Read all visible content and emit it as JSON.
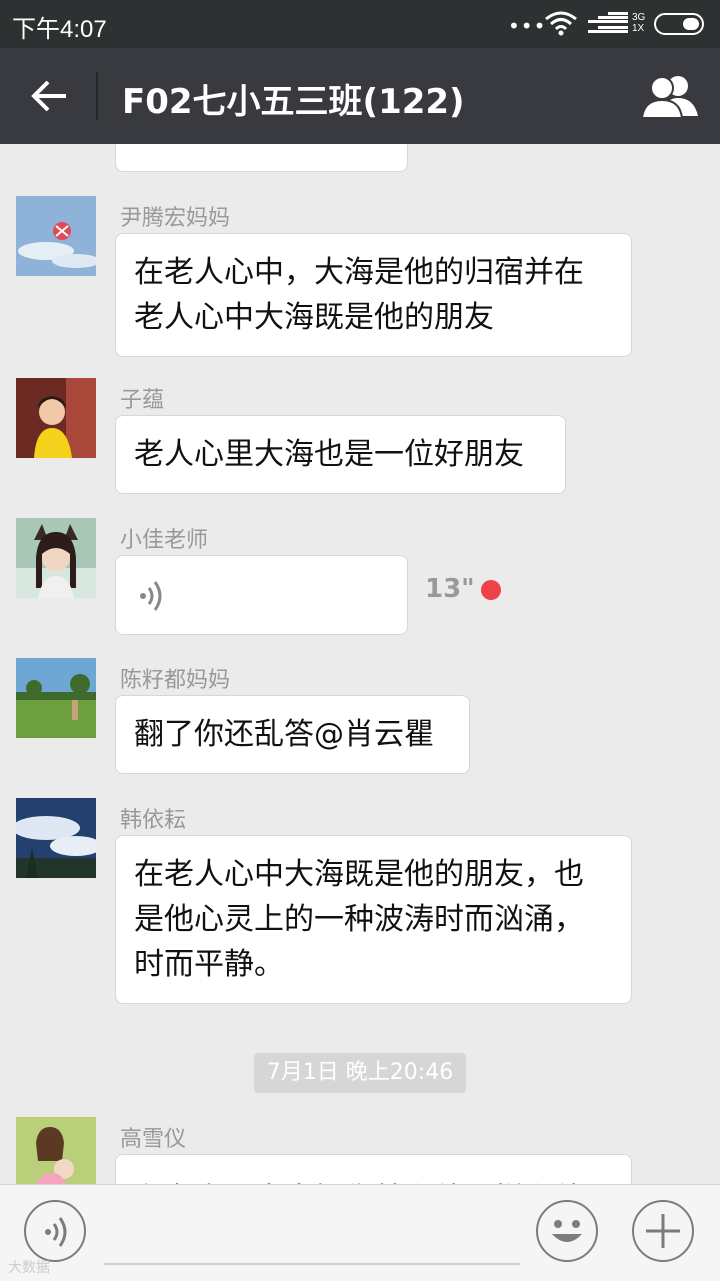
{
  "status_bar": {
    "time": "下午4:07",
    "network_top": "3G",
    "network_bottom": "1X"
  },
  "header": {
    "title": "F02七小五三班(122)"
  },
  "messages": [
    {
      "sender": "尹腾宏妈妈",
      "text": "在老人心中，大海是他的归宿并在老人心中大海既是他的朋友"
    },
    {
      "sender": "子蕴",
      "text": "老人心里大海也是一位好朋友"
    },
    {
      "sender": "小佳老师",
      "voice_duration": "13\""
    },
    {
      "sender": "陈籽都妈妈",
      "text": "翻了你还乱答@肖云瞿"
    },
    {
      "sender": "韩依耘",
      "text": "在老人心中大海既是他的朋友，也是他心灵上的一种波涛时而汹涌，时而平静。"
    }
  ],
  "time_divider": "7月1日 晚上20:46",
  "last_message": {
    "sender": "高雪仪",
    "text_partial": "在老人心中大好像就和他一样和他"
  },
  "watermark": "大数据"
}
